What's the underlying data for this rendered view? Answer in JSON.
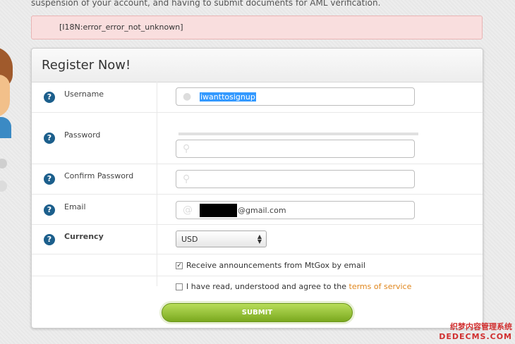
{
  "notice_text": "suspension of your account, and having to submit documents for AML verification.",
  "error_message": "[I18N:error_error_not_unknown]",
  "form": {
    "title": "Register Now!",
    "help_glyph": "?",
    "username": {
      "label": "Username",
      "value": "iwanttosignup"
    },
    "password": {
      "label": "Password"
    },
    "confirm_password": {
      "label": "Confirm Password"
    },
    "email": {
      "label": "Email",
      "value_suffix": "@gmail.com"
    },
    "currency": {
      "label": "Currency",
      "selected": "USD"
    },
    "announcements": {
      "label": "Receive announcements from MtGox by email",
      "checked": true
    },
    "terms": {
      "label_prefix": "I have read, understood and agree to the ",
      "link_text": "terms of service",
      "checked": false
    },
    "submit_label": "SUBMIT"
  },
  "icons": {
    "user": "user-icon",
    "key": "key-icon",
    "at": "at-sign-icon"
  },
  "colors": {
    "error_bg": "#f9dede",
    "help_icon": "#1c5f8c",
    "link": "#e0861c",
    "submit": "#8fc42a"
  },
  "watermark": {
    "line1": "织梦内容管理系统",
    "line2": "DEDECMS.COM"
  }
}
